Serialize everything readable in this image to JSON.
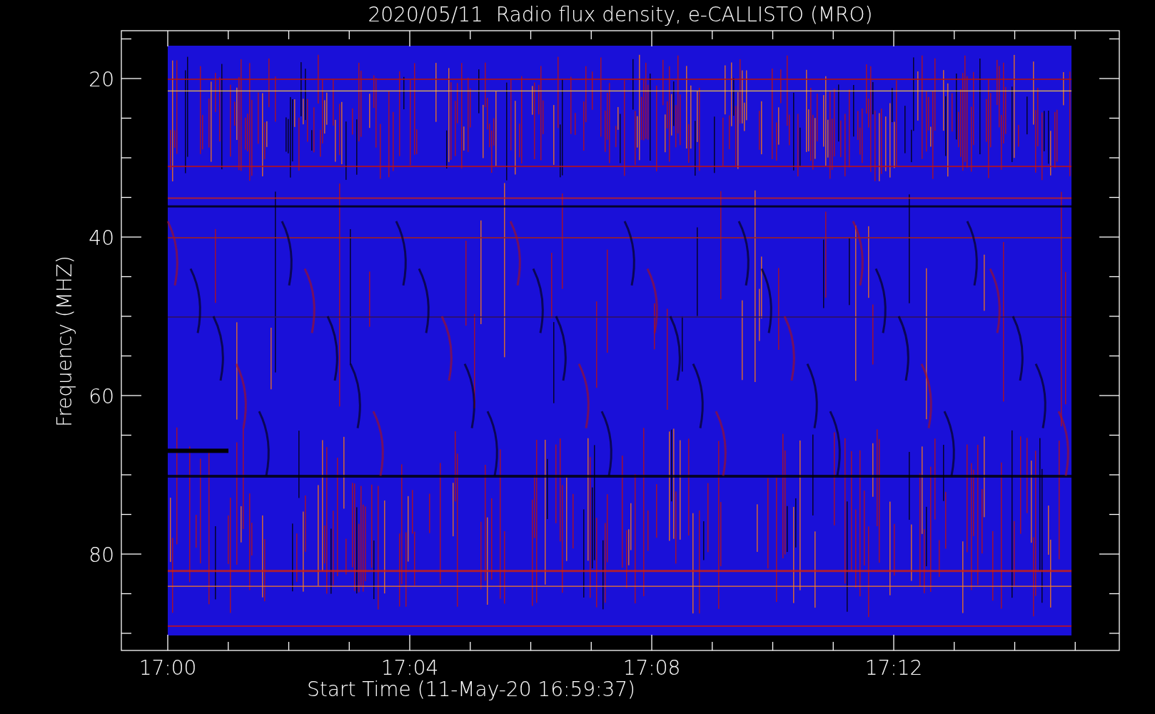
{
  "title": "2020/05/11  Radio flux density, e-CALLISTO (MRO)",
  "y_axis": {
    "label": "Frequency (MHZ)",
    "tick_labels": [
      "20",
      "40",
      "60",
      "80"
    ]
  },
  "x_axis": {
    "label": "Start Time (11-May-20 16:59:37)",
    "tick_labels": [
      "17:00",
      "17:04",
      "17:08",
      "17:12"
    ]
  }
}
